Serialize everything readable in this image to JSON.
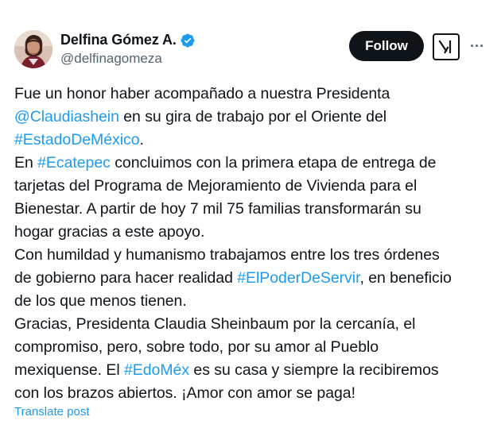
{
  "author": {
    "name": "Delfina Gómez A.",
    "handle": "@delfinagomeza",
    "avatar_icon": "profile-photo",
    "verified_icon": "verified-badge-icon",
    "verified_color": "#1d9bf0"
  },
  "actions": {
    "follow_label": "Follow",
    "grok_icon": "grok-icon",
    "more_icon": "more-options-icon",
    "more_glyph": "···"
  },
  "tweet": {
    "lines": [
      [
        {
          "t": "Fue un honor haber acompañado a nuestra Presidenta"
        }
      ],
      [
        {
          "t": "@Claudiashein",
          "link": true
        },
        {
          "t": " en su gira de trabajo por el Oriente del"
        }
      ],
      [
        {
          "t": "#EstadoDeMéxico",
          "link": true
        },
        {
          "t": "."
        }
      ],
      [
        {
          "t": "En "
        },
        {
          "t": "#Ecatepec",
          "link": true
        },
        {
          "t": " concluimos con la primera etapa de entrega de"
        }
      ],
      [
        {
          "t": "tarjetas del Programa de Mejoramiento de Vivienda para el"
        }
      ],
      [
        {
          "t": "Bienestar. A partir de hoy 7 mil 75 familias transformarán su"
        }
      ],
      [
        {
          "t": "hogar gracias a este apoyo."
        }
      ],
      [
        {
          "t": "Con humildad y humanismo trabajamos entre los tres órdenes"
        }
      ],
      [
        {
          "t": "de gobierno para hacer realidad "
        },
        {
          "t": "#ElPoderDeServir",
          "link": true
        },
        {
          "t": ", en beneficio"
        }
      ],
      [
        {
          "t": "de los que menos tienen."
        }
      ],
      [
        {
          "t": "Gracias, Presidenta Claudia Sheinbaum por la cercanía, el"
        }
      ],
      [
        {
          "t": "compromiso, pero, sobre todo, por su amor al Pueblo"
        }
      ],
      [
        {
          "t": "mexiquense. El "
        },
        {
          "t": "#EdoMéx",
          "link": true
        },
        {
          "t": " es su casa y siempre la recibiremos"
        }
      ],
      [
        {
          "t": "con los brazos abiertos. ¡Amor con amor se paga!"
        }
      ]
    ],
    "link_color": "#1d9bf0"
  },
  "footer": {
    "translate_label": "Translate post"
  }
}
